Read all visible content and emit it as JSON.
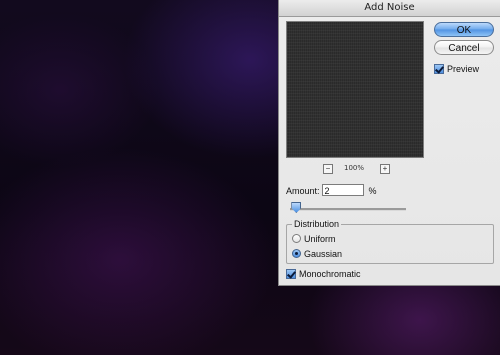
{
  "dialog": {
    "title": "Add Noise",
    "ok_label": "OK",
    "cancel_label": "Cancel",
    "preview": {
      "label": "Preview",
      "checked": true
    },
    "zoom": {
      "minus_icon": "minus-icon",
      "plus_icon": "plus-icon",
      "minus_glyph": "−",
      "plus_glyph": "+",
      "level": "100%"
    },
    "amount": {
      "label": "Amount:",
      "value": "2",
      "unit": "%",
      "slider_level": 0.02
    },
    "distribution": {
      "label": "Distribution",
      "options": [
        {
          "label": "Uniform",
          "selected": false
        },
        {
          "label": "Gaussian",
          "selected": true
        }
      ]
    },
    "monochromatic": {
      "label": "Monochromatic",
      "checked": true
    }
  },
  "colors": {
    "ok_button": "#6ea9ec",
    "canvas_dark": "#0d0612",
    "dialog_bg": "#e8e8e8"
  }
}
